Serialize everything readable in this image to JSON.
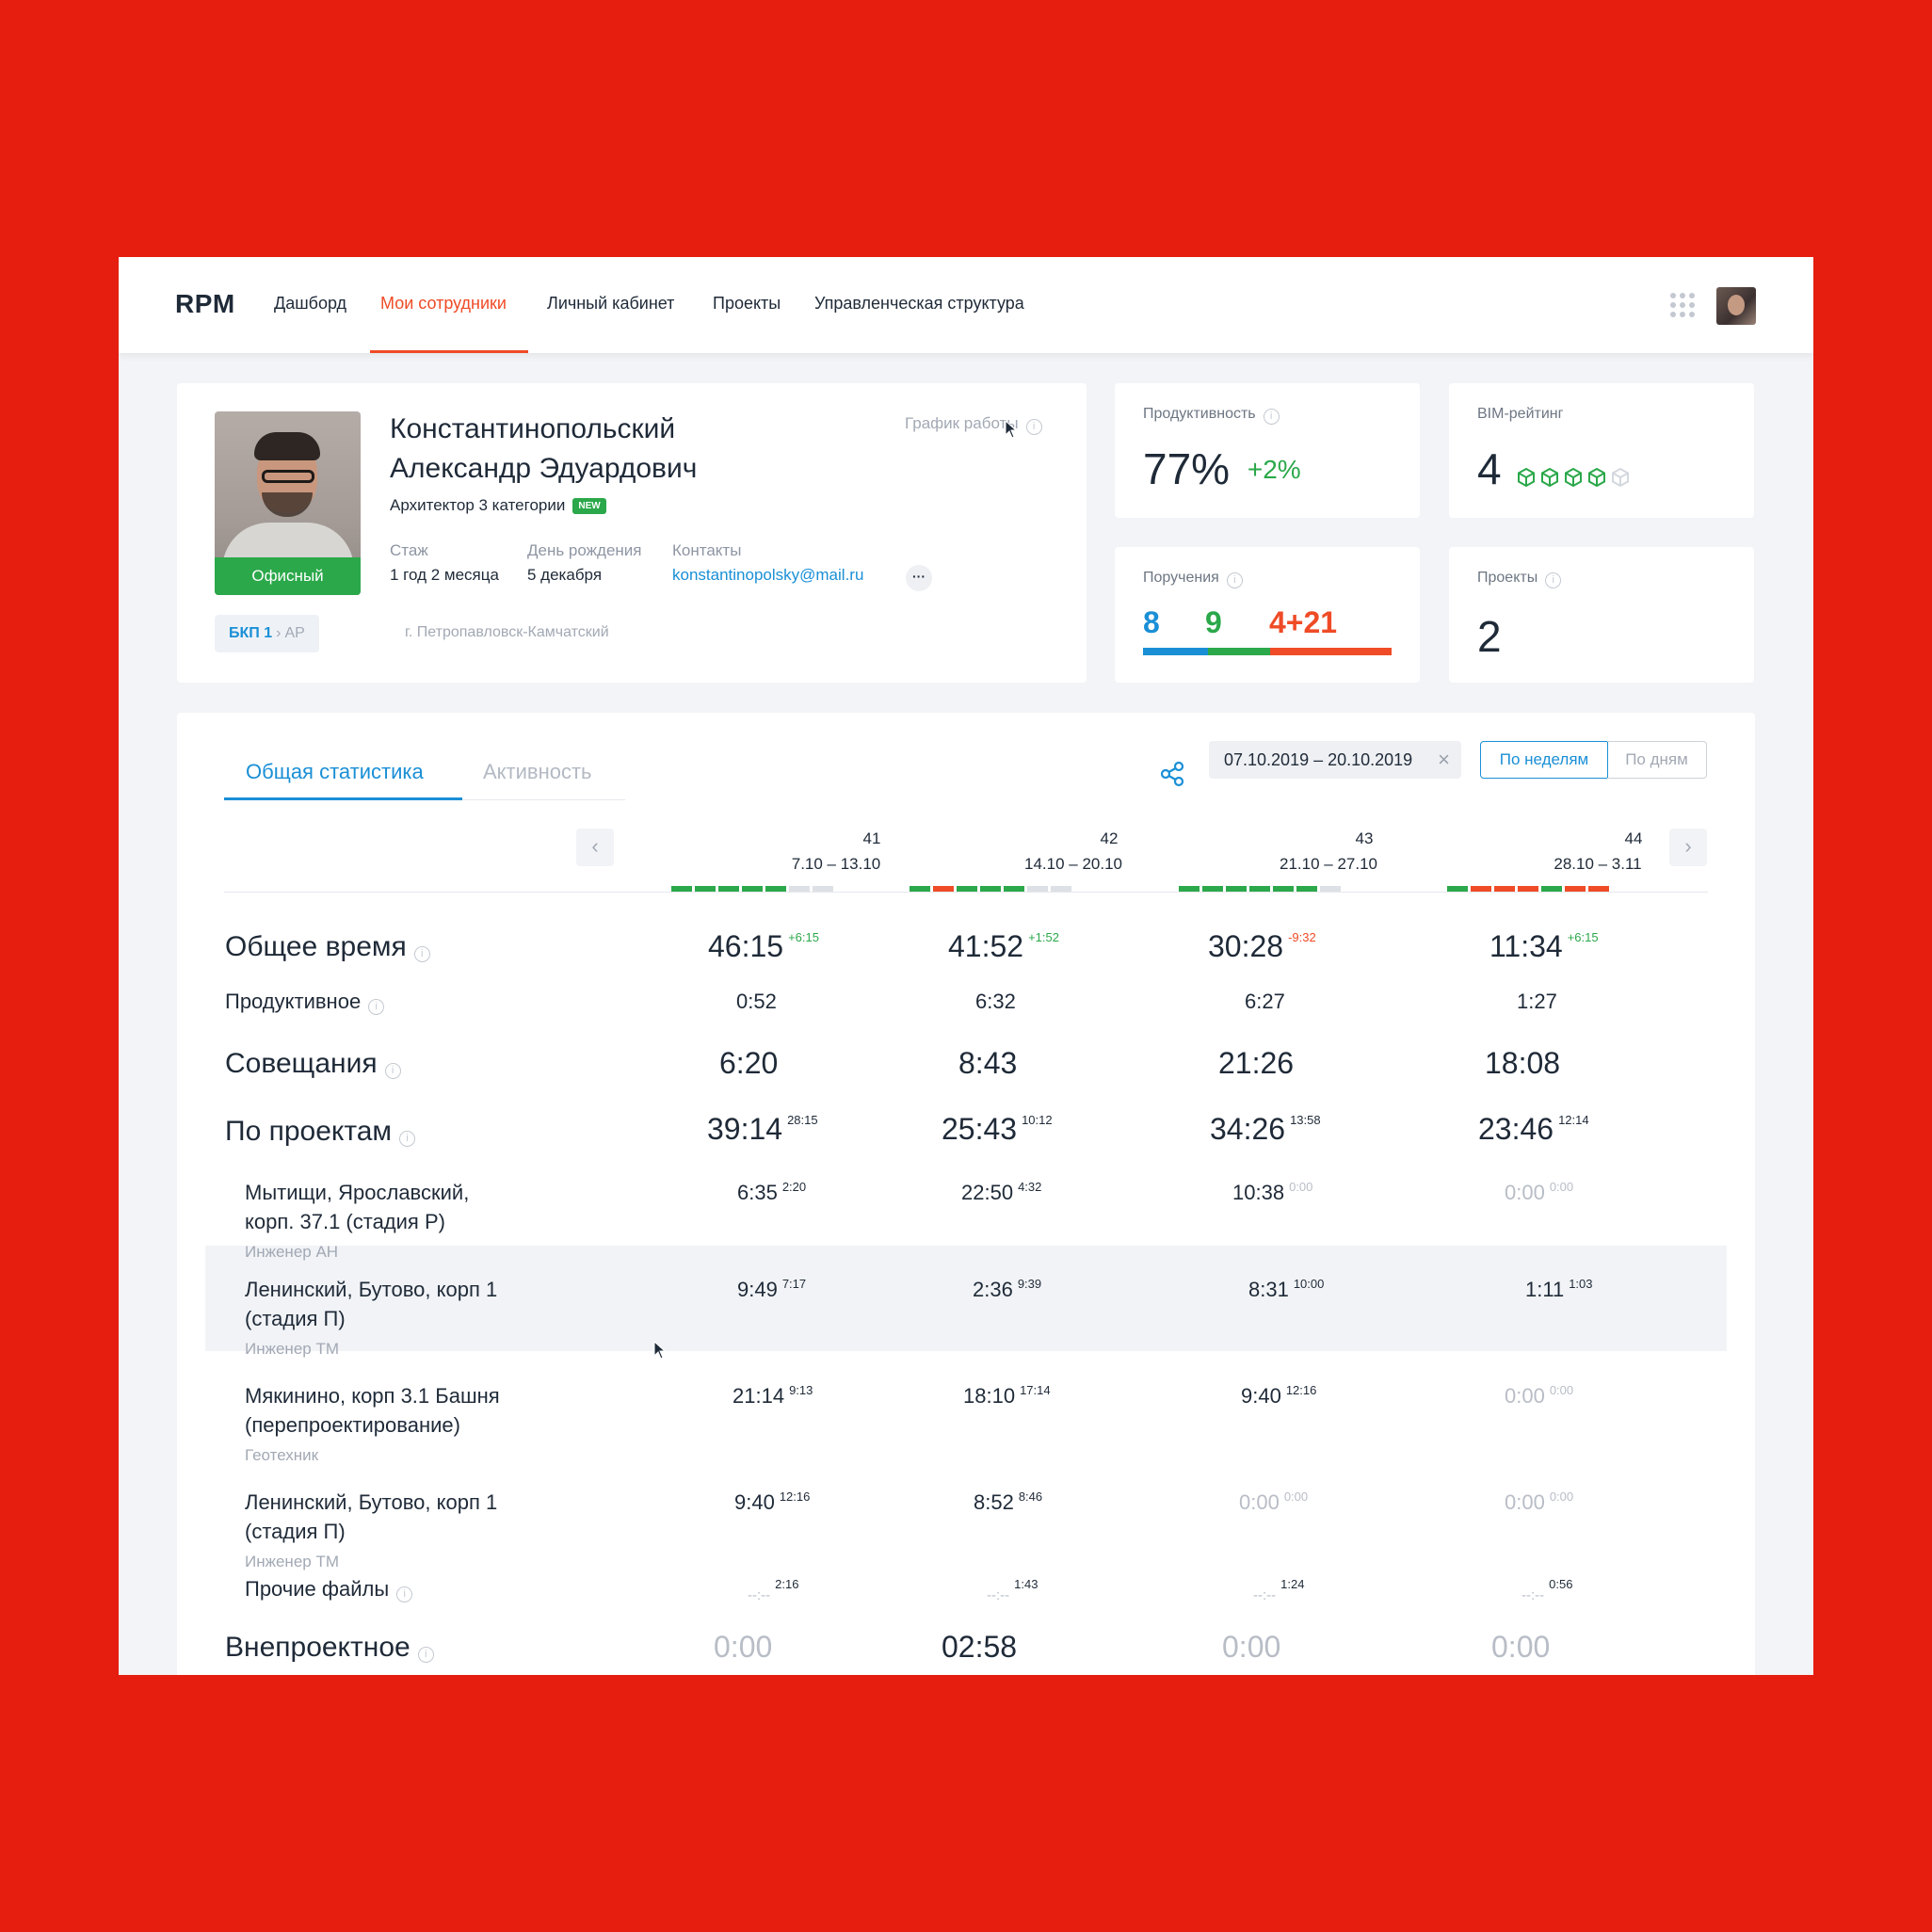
{
  "header": {
    "logo": "RPM",
    "nav": [
      "Дашборд",
      "Мои сотрудники",
      "Личный кабинет",
      "Проекты",
      "Управленческая структура"
    ]
  },
  "profile": {
    "name_line1": "Константинопольский",
    "name_line2": "Александр Эдуардович",
    "role": "Архитектор 3 категории",
    "role_badge": "NEW",
    "photo_badge": "Офисный",
    "schedule_label": "График работы",
    "fields": {
      "experience_label": "Стаж",
      "experience_value": "1 год 2 месяца",
      "birthday_label": "День рождения",
      "birthday_value": "5 декабря",
      "contacts_label": "Контакты",
      "email": "konstantinopolsky@mail.ru",
      "more": "···"
    },
    "dept_primary": "БКП 1",
    "dept_sep": "›",
    "dept_secondary": "АР",
    "city": "г. Петропавловск-Камчатский"
  },
  "stat_cards": {
    "productivity": {
      "label": "Продуктивность",
      "value": "77%",
      "delta": "+2%"
    },
    "bim": {
      "label": "BIM-рейтинг",
      "value": "4",
      "rating_filled": 4,
      "rating_total": 5
    },
    "tasks": {
      "label": "Поручения",
      "blue": "8",
      "green": "9",
      "red": "4+21",
      "bar_fractions": [
        0.26,
        0.25,
        0.49
      ],
      "colors": [
        "#1a8fd6",
        "#2ba84a",
        "#ef4b26"
      ]
    },
    "projects": {
      "label": "Проекты",
      "value": "2"
    }
  },
  "stats": {
    "tabs": [
      "Общая статистика",
      "Активность"
    ],
    "date_range": "07.10.2019 – 20.10.2019",
    "date_clear": "×",
    "mode_weeks": "По неделям",
    "mode_days": "По дням",
    "prev": "‹",
    "next": "›",
    "weeks": [
      {
        "num": "41",
        "range": "7.10 – 13.10",
        "days": [
          "g",
          "g",
          "g",
          "g",
          "g",
          "n",
          "n"
        ]
      },
      {
        "num": "42",
        "range": "14.10 – 20.10",
        "days": [
          "g",
          "r",
          "g",
          "g",
          "g",
          "n",
          "n"
        ]
      },
      {
        "num": "43",
        "range": "21.10 – 27.10",
        "days": [
          "g",
          "g",
          "g",
          "g",
          "g",
          "g",
          "n"
        ]
      },
      {
        "num": "44",
        "range": "28.10 – 3.11",
        "days": [
          "g",
          "r",
          "r",
          "r",
          "g",
          "r",
          "r"
        ]
      }
    ],
    "rows": {
      "total": {
        "label": "Общее время",
        "values": [
          "46:15",
          "41:52",
          "30:28",
          "11:34"
        ],
        "deltas": [
          "+6:15",
          "+1:52",
          "-9:32",
          "+6:15"
        ]
      },
      "productive": {
        "label": "Продуктивное",
        "values": [
          "0:52",
          "6:32",
          "6:27",
          "1:27"
        ]
      },
      "meetings": {
        "label": "Совещания",
        "values": [
          "6:20",
          "8:43",
          "21:26",
          "18:08"
        ]
      },
      "by_projects": {
        "label": "По проектам",
        "values": [
          "39:14",
          "25:43",
          "34:26",
          "23:46"
        ],
        "sub": [
          "28:15",
          "10:12",
          "13:58",
          "12:14"
        ]
      },
      "projects": [
        {
          "line1": "Мытищи, Ярославский,",
          "line2": "корп. 37.1 (стадия Р)",
          "role": "Инженер АН",
          "values": [
            "6:35",
            "22:50",
            "10:38",
            "0:00"
          ],
          "sub": [
            "2:20",
            "4:32",
            "0:00",
            "0:00"
          ]
        },
        {
          "line1": "Ленинский, Бутово, корп 1",
          "line2": "(стадия П)",
          "role": "Инженер ТМ",
          "values": [
            "9:49",
            "2:36",
            "8:31",
            "1:11"
          ],
          "sub": [
            "7:17",
            "9:39",
            "10:00",
            "1:03"
          ]
        },
        {
          "line1": "Мякинино, корп 3.1 Башня",
          "line2": "(перепроектирование)",
          "role": "Геотехник",
          "values": [
            "21:14",
            "18:10",
            "9:40",
            "0:00"
          ],
          "sub": [
            "9:13",
            "17:14",
            "12:16",
            "0:00"
          ]
        },
        {
          "line1": "Ленинский, Бутово, корп 1",
          "line2": "(стадия П)",
          "role": "Инженер ТМ",
          "values": [
            "9:40",
            "8:52",
            "0:00",
            "0:00"
          ],
          "sub": [
            "12:16",
            "8:46",
            "0:00",
            "0:00"
          ]
        }
      ],
      "other_files": {
        "label": "Прочие файлы",
        "values": [
          "--:--",
          "--:--",
          "--:--",
          "--:--"
        ],
        "sub": [
          "2:16",
          "1:43",
          "1:24",
          "0:56"
        ]
      },
      "non_project": {
        "label": "Внепроектное",
        "values": [
          "0:00",
          "02:58",
          "0:00",
          "0:00"
        ]
      }
    }
  },
  "colors": {
    "accent": "#ef4b26",
    "blue": "#1a8fd6",
    "green": "#2ba84a",
    "background": "#e51e0f"
  }
}
